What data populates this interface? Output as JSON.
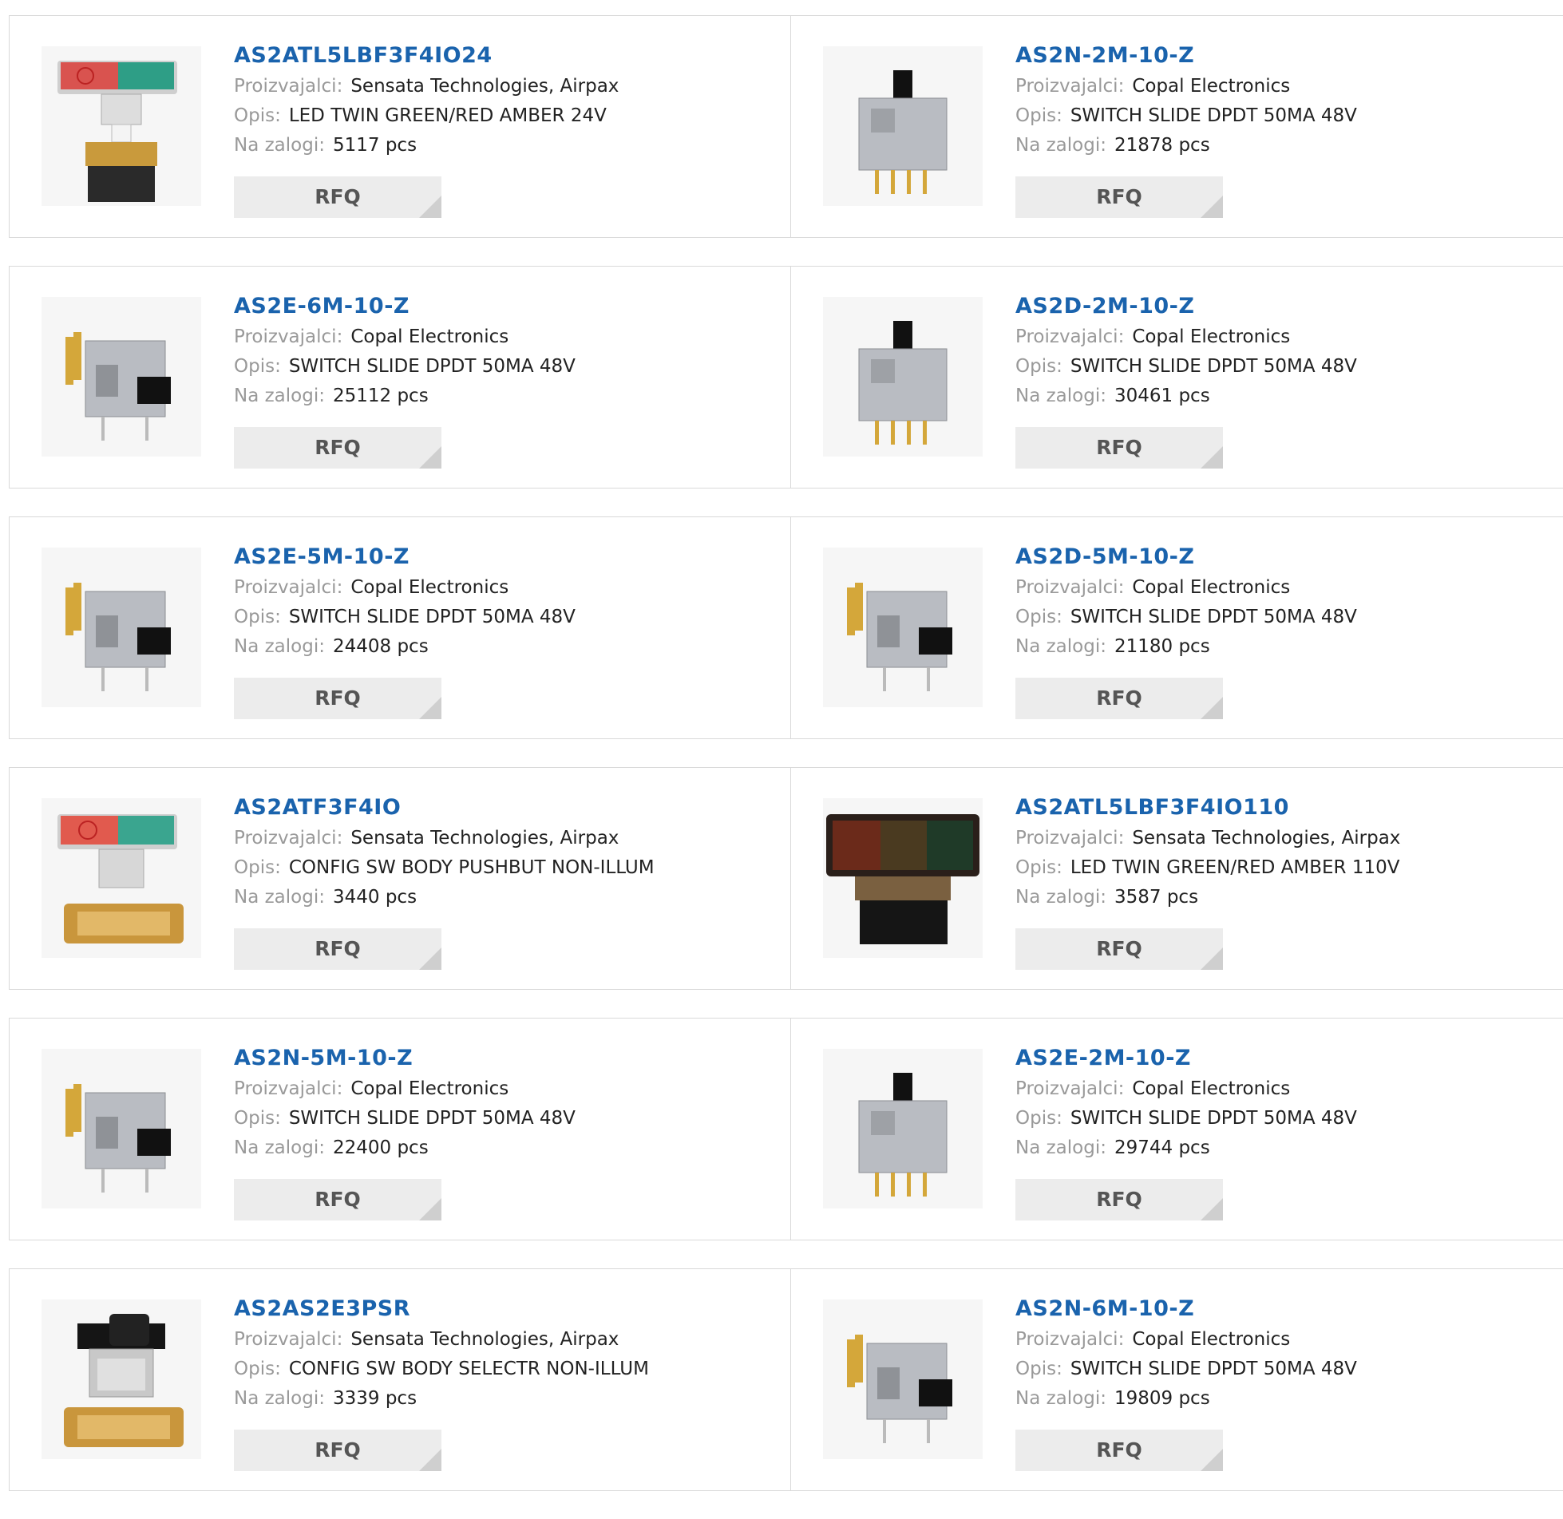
{
  "labels": {
    "manufacturer": "Proizvajalci:",
    "description": "Opis:",
    "stock": "Na zalogi:",
    "rfq": "RFQ"
  },
  "colors": {
    "part_link": "#1a63ad",
    "label": "#999999",
    "rfq_background": "#ececec"
  },
  "products": [
    {
      "part": "AS2ATL5LBF3F4IO24",
      "manufacturer": "Sensata Technologies, Airpax",
      "description": "LED TWIN GREEN/RED AMBER 24V",
      "stock": "5117 pcs",
      "image": "twin-pushbutton"
    },
    {
      "part": "AS2N-2M-10-Z",
      "manufacturer": "Copal Electronics",
      "description": "SWITCH SLIDE DPDT 50MA 48V",
      "stock": "21878 pcs",
      "image": "slide-switch-vertical"
    },
    {
      "part": "AS2E-6M-10-Z",
      "manufacturer": "Copal Electronics",
      "description": "SWITCH SLIDE DPDT 50MA 48V",
      "stock": "25112 pcs",
      "image": "slide-switch-right-angle"
    },
    {
      "part": "AS2D-2M-10-Z",
      "manufacturer": "Copal Electronics",
      "description": "SWITCH SLIDE DPDT 50MA 48V",
      "stock": "30461 pcs",
      "image": "slide-switch-vertical"
    },
    {
      "part": "AS2E-5M-10-Z",
      "manufacturer": "Copal Electronics",
      "description": "SWITCH SLIDE DPDT 50MA 48V",
      "stock": "24408 pcs",
      "image": "slide-switch-right-angle"
    },
    {
      "part": "AS2D-5M-10-Z",
      "manufacturer": "Copal Electronics",
      "description": "SWITCH SLIDE DPDT 50MA 48V",
      "stock": "21180 pcs",
      "image": "slide-switch-right-angle"
    },
    {
      "part": "AS2ATF3F4IO",
      "manufacturer": "Sensata Technologies, Airpax",
      "description": "CONFIG SW BODY PUSHBUT NON-ILLUM",
      "stock": "3440 pcs",
      "image": "twin-pushbutton-body"
    },
    {
      "part": "AS2ATL5LBF3F4IO110",
      "manufacturer": "Sensata Technologies, Airpax",
      "description": "LED TWIN GREEN/RED AMBER 110V",
      "stock": "3587 pcs",
      "image": "twin-pushbutton-dark"
    },
    {
      "part": "AS2N-5M-10-Z",
      "manufacturer": "Copal Electronics",
      "description": "SWITCH SLIDE DPDT 50MA 48V",
      "stock": "22400 pcs",
      "image": "slide-switch-right-angle"
    },
    {
      "part": "AS2E-2M-10-Z",
      "manufacturer": "Copal Electronics",
      "description": "SWITCH SLIDE DPDT 50MA 48V",
      "stock": "29744 pcs",
      "image": "slide-switch-vertical"
    },
    {
      "part": "AS2AS2E3PSR",
      "manufacturer": "Sensata Technologies, Airpax",
      "description": "CONFIG SW BODY SELECTR NON-ILLUM",
      "stock": "3339 pcs",
      "image": "selector-switch"
    },
    {
      "part": "AS2N-6M-10-Z",
      "manufacturer": "Copal Electronics",
      "description": "SWITCH SLIDE DPDT 50MA 48V",
      "stock": "19809 pcs",
      "image": "slide-switch-right-angle"
    }
  ]
}
